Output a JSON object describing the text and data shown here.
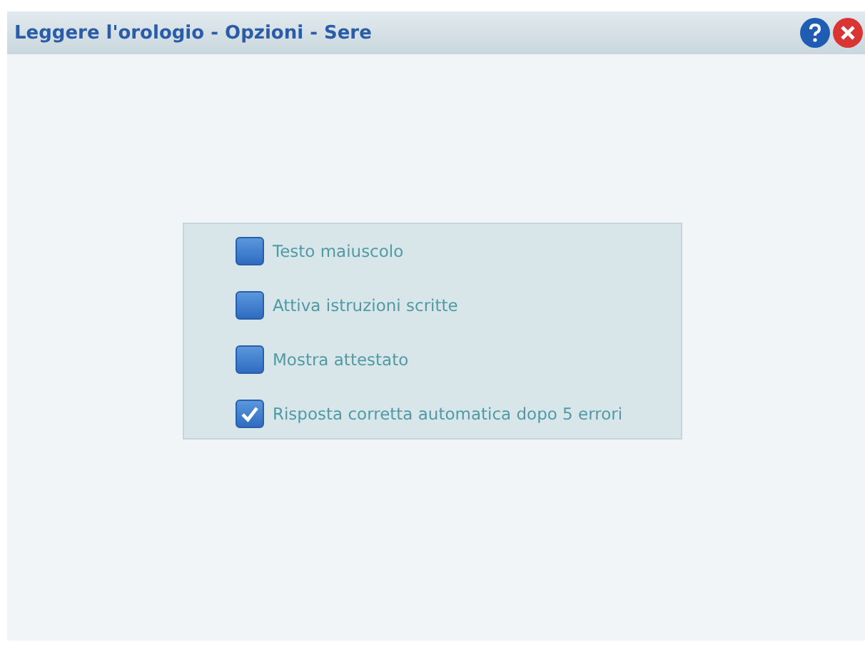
{
  "window": {
    "title": "Leggere l'orologio - Opzioni - Sere"
  },
  "options": [
    {
      "label": "Testo maiuscolo",
      "checked": false
    },
    {
      "label": "Attiva istruzioni scritte",
      "checked": false
    },
    {
      "label": "Mostra attestato",
      "checked": false
    },
    {
      "label": "Risposta corretta automatica dopo 5 errori",
      "checked": true
    }
  ]
}
